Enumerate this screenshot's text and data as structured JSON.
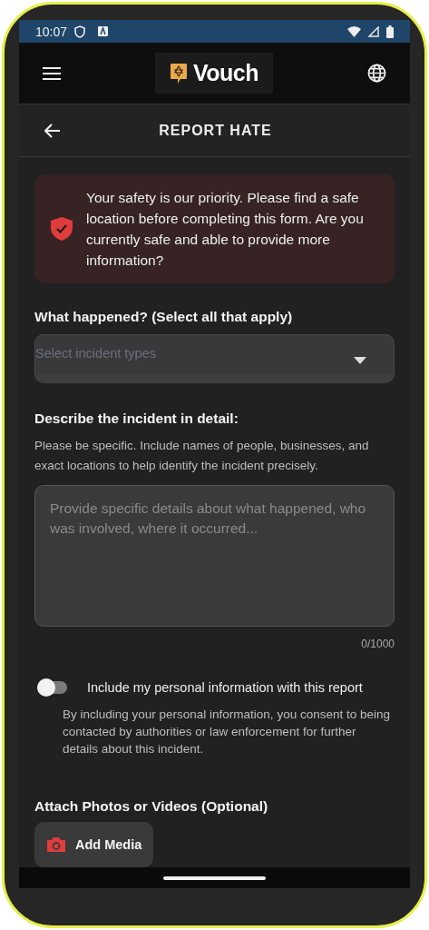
{
  "status_bar": {
    "time": "10:07"
  },
  "header": {
    "logo_text": "Vouch"
  },
  "page_title": "REPORT HATE",
  "alert": {
    "text": "Your safety is our priority. Please find a safe location before completing this form. Are you currently safe and able to provide more information?"
  },
  "incident_types": {
    "label": "What happened? (Select all that apply)",
    "placeholder": "Select incident types"
  },
  "details": {
    "label": "Describe the incident in detail:",
    "help": "Please be specific. Include names of people, businesses, and exact locations to help identify the incident precisely.",
    "placeholder": "Provide specific details about what happened, who was involved, where it occurred...",
    "counter": "0/1000"
  },
  "personal_info": {
    "label": "Include my personal information with this report",
    "on": false,
    "description": "By including your personal information, you consent to being contacted by authorities or law enforcement for further details about this incident."
  },
  "attach": {
    "label": "Attach Photos or Videos (Optional)",
    "button": "Add Media"
  }
}
